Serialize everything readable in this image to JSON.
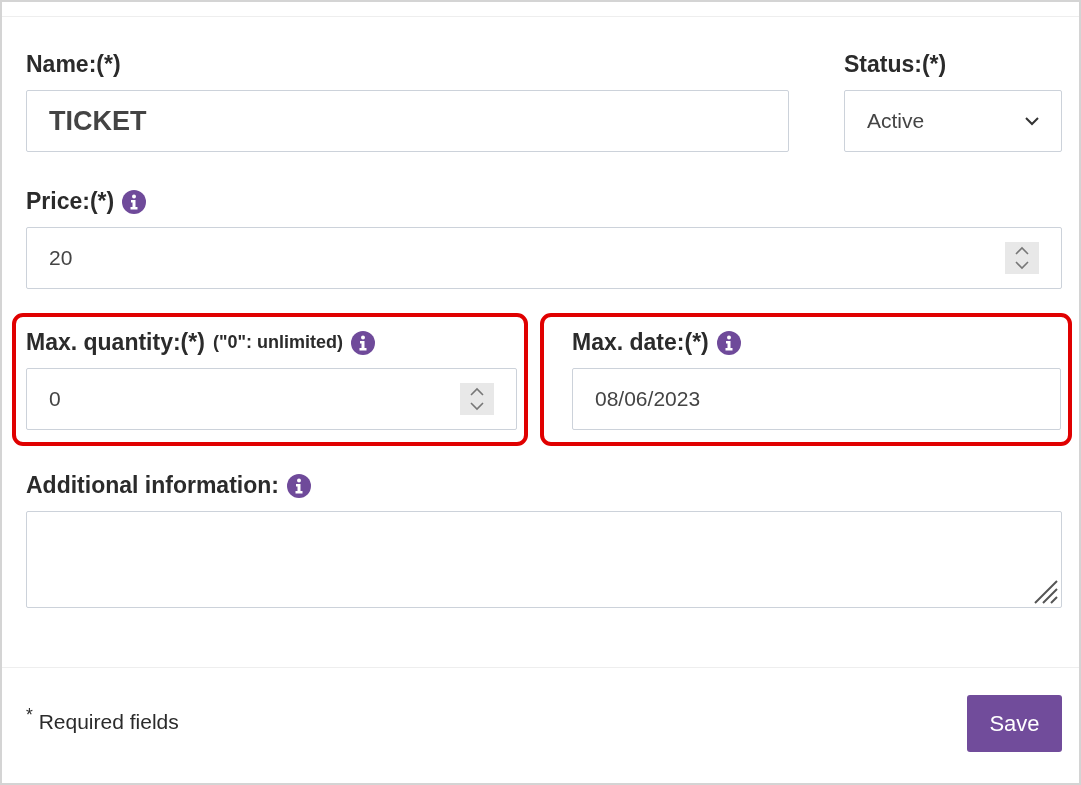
{
  "form": {
    "name": {
      "label": "Name:(*)",
      "value": "TICKET"
    },
    "status": {
      "label": "Status:(*)",
      "value": "Active"
    },
    "price": {
      "label": "Price:(*)",
      "value": "20",
      "info": true
    },
    "max_quantity": {
      "label": "Max. quantity:(*)",
      "hint": "(\"0\": unlimited)",
      "value": "0",
      "info": true,
      "highlighted": true
    },
    "max_date": {
      "label": "Max. date:(*)",
      "value": "08/06/2023",
      "info": true,
      "highlighted": true
    },
    "additional_information": {
      "label": "Additional information:",
      "info": true
    }
  },
  "footer": {
    "note": "$^{*}$ Required fields",
    "save_button": "Save"
  }
}
